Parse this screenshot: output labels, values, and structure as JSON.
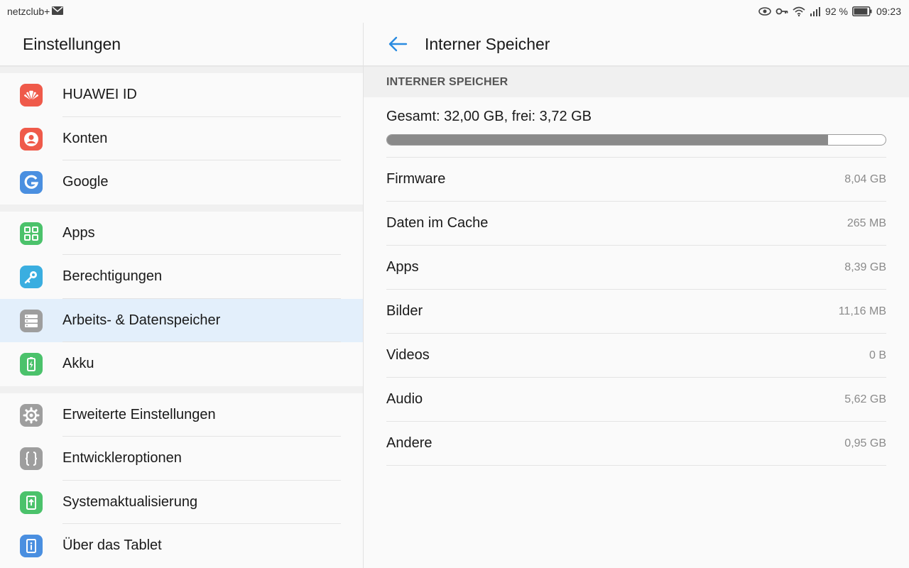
{
  "status_bar": {
    "carrier": "netzclub+",
    "battery_percent": "92 %",
    "battery_level": 0.92,
    "time": "09:23"
  },
  "left_pane": {
    "title": "Einstellungen",
    "groups": [
      [
        {
          "label": "HUAWEI ID",
          "icon": "huawei-icon",
          "color": "#ef5a4a"
        },
        {
          "label": "Konten",
          "icon": "account-icon",
          "color": "#ef5a4a"
        },
        {
          "label": "Google",
          "icon": "google-icon",
          "color": "#4a8fe0"
        }
      ],
      [
        {
          "label": "Apps",
          "icon": "apps-grid-icon",
          "color": "#4bc26b"
        },
        {
          "label": "Berechtigungen",
          "icon": "key-icon",
          "color": "#3aaee0"
        },
        {
          "label": "Arbeits- & Datenspeicher",
          "icon": "storage-icon",
          "color": "#9e9e9e",
          "selected": true
        },
        {
          "label": "Akku",
          "icon": "battery-icon",
          "color": "#4bc26b"
        }
      ],
      [
        {
          "label": "Erweiterte Einstellungen",
          "icon": "gear-icon",
          "color": "#9e9e9e"
        },
        {
          "label": "Entwickleroptionen",
          "icon": "braces-icon",
          "color": "#9e9e9e"
        },
        {
          "label": "Systemaktualisierung",
          "icon": "system-update-icon",
          "color": "#4bc26b"
        },
        {
          "label": "Über das Tablet",
          "icon": "info-icon",
          "color": "#4a8fe0"
        }
      ]
    ]
  },
  "right_pane": {
    "title": "Interner Speicher",
    "section_header": "INTERNER SPEICHER",
    "summary": "Gesamt: 32,00 GB, frei: 3,72 GB",
    "used_fraction": 0.884,
    "accent_color": "#2a8be0",
    "rows": [
      {
        "label": "Firmware",
        "value": "8,04 GB"
      },
      {
        "label": "Daten im Cache",
        "value": "265 MB"
      },
      {
        "label": "Apps",
        "value": "8,39 GB"
      },
      {
        "label": "Bilder",
        "value": "11,16 MB"
      },
      {
        "label": "Videos",
        "value": "0 B"
      },
      {
        "label": "Audio",
        "value": "5,62 GB"
      },
      {
        "label": "Andere",
        "value": "0,95 GB"
      }
    ]
  }
}
